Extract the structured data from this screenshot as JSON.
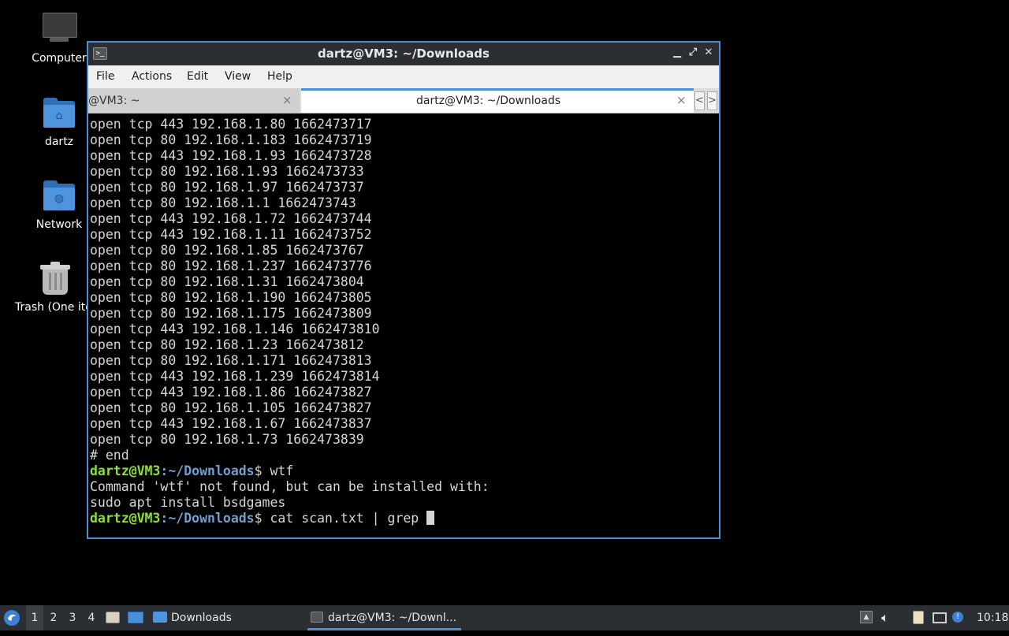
{
  "desktop": {
    "icons": [
      {
        "label": "Computer"
      },
      {
        "label": "dartz"
      },
      {
        "label": "Network"
      },
      {
        "label": "Trash (One ite"
      }
    ]
  },
  "window": {
    "title": "dartz@VM3: ~/Downloads",
    "menu": [
      "File",
      "Actions",
      "Edit",
      "View",
      "Help"
    ],
    "tabs": [
      {
        "label": "@VM3: ~",
        "active": false
      },
      {
        "label": "dartz@VM3: ~/Downloads",
        "active": true
      }
    ],
    "tab_close_glyph": "×",
    "scroll_left": "<",
    "scroll_right": ">"
  },
  "terminal": {
    "output": [
      "open tcp 443 192.168.1.80 1662473717",
      "open tcp 80 192.168.1.183 1662473719",
      "open tcp 443 192.168.1.93 1662473728",
      "open tcp 80 192.168.1.93 1662473733",
      "open tcp 80 192.168.1.97 1662473737",
      "open tcp 80 192.168.1.1 1662473743",
      "open tcp 443 192.168.1.72 1662473744",
      "open tcp 443 192.168.1.11 1662473752",
      "open tcp 80 192.168.1.85 1662473767",
      "open tcp 80 192.168.1.237 1662473776",
      "open tcp 80 192.168.1.31 1662473804",
      "open tcp 80 192.168.1.190 1662473805",
      "open tcp 80 192.168.1.175 1662473809",
      "open tcp 443 192.168.1.146 1662473810",
      "open tcp 80 192.168.1.23 1662473812",
      "open tcp 80 192.168.1.171 1662473813",
      "open tcp 443 192.168.1.239 1662473814",
      "open tcp 443 192.168.1.86 1662473827",
      "open tcp 80 192.168.1.105 1662473827",
      "open tcp 443 192.168.1.67 1662473837",
      "open tcp 80 192.168.1.73 1662473839",
      "# end"
    ],
    "prompt_user": "dartz@VM3",
    "prompt_sep": ":",
    "prompt_path": "~/Downloads",
    "prompt_suffix": "$ ",
    "cmd1": "wtf",
    "error_lines": [
      "Command 'wtf' not found, but can be installed with:",
      "sudo apt install bsdgames"
    ],
    "cmd2": "cat scan.txt | grep "
  },
  "taskbar": {
    "workspaces": [
      "1",
      "2",
      "3",
      "4"
    ],
    "current_workspace": "1",
    "tasks": [
      {
        "label": "Downloads"
      },
      {
        "label": "dartz@VM3: ~/Downl..."
      }
    ],
    "clock": "10:18"
  },
  "colors": {
    "accent": "#4a90d9",
    "prompt_user": "#8ae234",
    "prompt_path": "#729fcf",
    "terminal_fg": "#d3d7cf",
    "panel": "#2b2f33"
  }
}
